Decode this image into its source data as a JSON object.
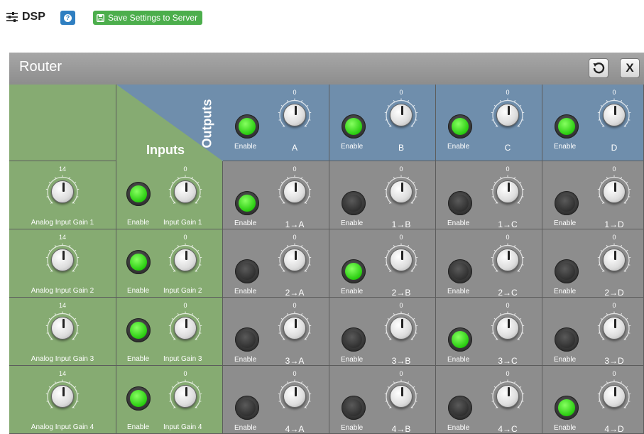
{
  "header": {
    "title": "DSP",
    "help_label": "?",
    "save_label": "Save Settings to Server"
  },
  "router": {
    "title": "Router",
    "inputs_label": "Inputs",
    "outputs_label": "Outputs",
    "enable_label": "Enable",
    "outputs": [
      {
        "name": "A",
        "gain": "0",
        "enabled": true
      },
      {
        "name": "B",
        "gain": "0",
        "enabled": true
      },
      {
        "name": "C",
        "gain": "0",
        "enabled": true
      },
      {
        "name": "D",
        "gain": "0",
        "enabled": true
      }
    ],
    "rows": [
      {
        "analog_label": "Analog Input Gain 1",
        "analog_gain": "14",
        "input_label": "Input Gain 1",
        "input_gain": "0",
        "input_enabled": true,
        "routes": [
          {
            "name": "1→A",
            "gain": "0",
            "enabled": true
          },
          {
            "name": "1→B",
            "gain": "0",
            "enabled": false
          },
          {
            "name": "1→C",
            "gain": "0",
            "enabled": false
          },
          {
            "name": "1→D",
            "gain": "0",
            "enabled": false
          }
        ]
      },
      {
        "analog_label": "Analog Input Gain 2",
        "analog_gain": "14",
        "input_label": "Input Gain 2",
        "input_gain": "0",
        "input_enabled": true,
        "routes": [
          {
            "name": "2→A",
            "gain": "0",
            "enabled": false
          },
          {
            "name": "2→B",
            "gain": "0",
            "enabled": true
          },
          {
            "name": "2→C",
            "gain": "0",
            "enabled": false
          },
          {
            "name": "2→D",
            "gain": "0",
            "enabled": false
          }
        ]
      },
      {
        "analog_label": "Analog Input Gain 3",
        "analog_gain": "14",
        "input_label": "Input Gain 3",
        "input_gain": "0",
        "input_enabled": true,
        "routes": [
          {
            "name": "3→A",
            "gain": "0",
            "enabled": false
          },
          {
            "name": "3→B",
            "gain": "0",
            "enabled": false
          },
          {
            "name": "3→C",
            "gain": "0",
            "enabled": true
          },
          {
            "name": "3→D",
            "gain": "0",
            "enabled": false
          }
        ]
      },
      {
        "analog_label": "Analog Input Gain 4",
        "analog_gain": "14",
        "input_label": "Input Gain 4",
        "input_gain": "0",
        "input_enabled": true,
        "routes": [
          {
            "name": "4→A",
            "gain": "0",
            "enabled": false
          },
          {
            "name": "4→B",
            "gain": "0",
            "enabled": false
          },
          {
            "name": "4→C",
            "gain": "0",
            "enabled": false
          },
          {
            "name": "4→D",
            "gain": "0",
            "enabled": true
          }
        ]
      }
    ]
  },
  "colors": {
    "green_panel": "#86ab72",
    "blue_panel": "#6f8eac",
    "gray_panel": "#8d8d8d",
    "led_on": "#22c80a",
    "save_button": "#4cae4c",
    "help_button": "#2f7fc1"
  },
  "icons": {
    "dsp": "sliders-icon",
    "help": "question-circle-icon",
    "save": "floppy-disk-icon",
    "reset": "undo-icon",
    "close": "close-icon"
  }
}
